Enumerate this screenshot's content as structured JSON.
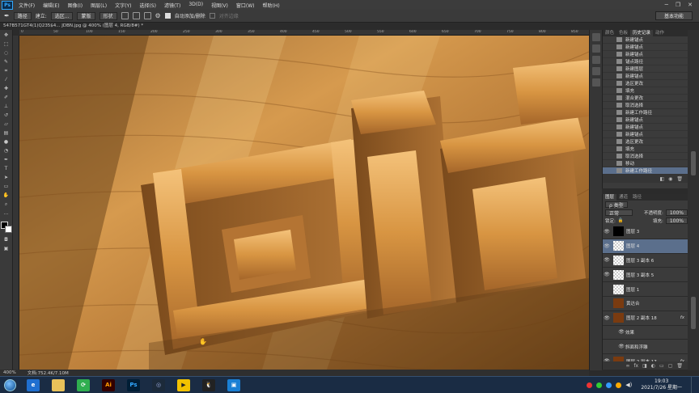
{
  "app": {
    "logo": "Ps"
  },
  "menus": [
    "文件(F)",
    "编辑(E)",
    "图像(I)",
    "图层(L)",
    "文字(Y)",
    "选择(S)",
    "滤镜(T)",
    "3D(D)",
    "视图(V)",
    "窗口(W)",
    "帮助(H)"
  ],
  "window_controls": {
    "minimize": "─",
    "restore": "❐",
    "close": "✕"
  },
  "options_bar": {
    "mode": "路径",
    "build_label": "建立:",
    "select_button": "选区...",
    "mask_button": "蒙版",
    "shape_button": "形状",
    "auto_add_delete": "自动添加/删除",
    "align_edges": "对齐边缘"
  },
  "workspace": "基本功能",
  "document": {
    "tab_title": "547B571GT4(1)Q235$4... JDBN.jpg @ 400% (图层 4, RGB/8#) *",
    "zoom": "400%",
    "doc_size": "文档:752.4K/7.10M"
  },
  "ruler_ticks": [
    "0",
    "50",
    "100",
    "150",
    "200",
    "250",
    "300",
    "350",
    "400",
    "450",
    "500",
    "550",
    "600",
    "650",
    "700",
    "750",
    "800",
    "850"
  ],
  "history_panel": {
    "tabs": [
      "颜色",
      "色板",
      "历史记录",
      "动作"
    ],
    "active_tab": 2,
    "items": [
      "新建锚点",
      "新建锚点",
      "新建锚点",
      "锚点路径",
      "新建图层",
      "新建锚点",
      "选区更改",
      "填充",
      "混合更改",
      "取消选择",
      "新建工作路径",
      "新建锚点",
      "新建锚点",
      "新建锚点",
      "选区更改",
      "填充",
      "取消选择",
      "移动",
      "新建工作路径"
    ],
    "selected_index": 18
  },
  "layers_panel": {
    "tabs": [
      "图层",
      "通道",
      "路径"
    ],
    "active_tab": 0,
    "filter": "ρ 类型",
    "blend_mode": "正常",
    "opacity_label": "不透明度:",
    "opacity": "100%",
    "lock_label": "锁定:",
    "fill_label": "填充:",
    "fill": "100%",
    "layers": [
      {
        "name": "图层 3",
        "thumb": "black",
        "visible": true,
        "fx": "",
        "selected": false
      },
      {
        "name": "图层 4",
        "thumb": "checker",
        "visible": true,
        "fx": "",
        "selected": true
      },
      {
        "name": "图层 3 副本 6",
        "thumb": "checker",
        "visible": true,
        "fx": "",
        "selected": false
      },
      {
        "name": "图层 3 副本 5",
        "thumb": "checker",
        "visible": true,
        "fx": "",
        "selected": false
      },
      {
        "name": "图层 1",
        "thumb": "checker",
        "visible": false,
        "fx": "",
        "selected": false
      },
      {
        "name": "黄达合",
        "thumb": "img",
        "visible": false,
        "fx": "",
        "selected": false
      },
      {
        "name": "图层 2 副本 18",
        "thumb": "img",
        "visible": true,
        "fx": "fx",
        "selected": false
      },
      {
        "name": "效果",
        "thumb": "none",
        "visible": true,
        "fx": "",
        "selected": false
      },
      {
        "name": "斜面和浮雕",
        "thumb": "none",
        "visible": true,
        "fx": "",
        "selected": false
      },
      {
        "name": "图层 2 副本 17",
        "thumb": "img",
        "visible": true,
        "fx": "fx",
        "selected": false
      }
    ]
  },
  "taskbar": {
    "apps": [
      "ie",
      "folder",
      "360",
      "Ai",
      "Ps",
      "c4d",
      "Player",
      "qq",
      "video"
    ],
    "clock_time": "19:03",
    "clock_date": "2021/7/26 星期一"
  },
  "colors": {
    "accent_selected": "#5b6f8c",
    "taskbar": "#1a2c44",
    "wood": "#c98a3e"
  }
}
